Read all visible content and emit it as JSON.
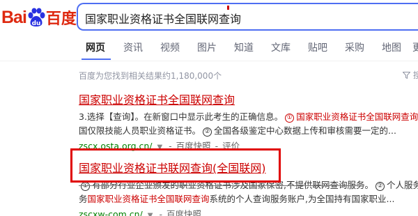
{
  "logo": {
    "text_en": "Bai",
    "paw_icon": "baidu-paw-icon",
    "text_cn": "百度"
  },
  "search": {
    "query": "国家职业资格证书全国联网查询"
  },
  "tabs": [
    {
      "label": "网页",
      "active": true
    },
    {
      "label": "资讯"
    },
    {
      "label": "视频"
    },
    {
      "label": "图片"
    },
    {
      "label": "知道"
    },
    {
      "label": "文库"
    },
    {
      "label": "贴吧"
    },
    {
      "label": "采购"
    },
    {
      "label": "地图"
    },
    {
      "label": "更"
    }
  ],
  "stats": {
    "text": "百度为您找到相关结果约1,180,000个",
    "tools_label": "搜"
  },
  "results": [
    {
      "title": "国家职业资格证书全国联网查询",
      "snippet_line1_a": "3.选择【查询】。在新窗口中显示此考生的正确信息。",
      "snippet_line1_num": "①",
      "snippet_line1_b": "国家职业资格证书全国联网查询",
      "snippet_line2_a": "国仅限技能人员职业资格证书。",
      "snippet_line2_num": "②",
      "snippet_line2_b": "全国各级鉴定中心数据上传和审核需要一定的...",
      "url": "zscx.osta.org.cn/",
      "snapshot": "百度快照",
      "sep": "-",
      "review": "评价"
    },
    {
      "title_main": "国家职业资格证书联网查询",
      "title_paren": "(全国联网)",
      "snippet_line1_num": "①",
      "snippet_line1_a": "有部分行业企业颁发的职业资格证书涉及国家保密,不提供联网查询服务。",
      "snippet_line1_num2": "②",
      "snippet_line1_b": "个人服务",
      "snippet_line2_a": "务",
      "snippet_line2_b": "国家职业资格证书全国联网查询",
      "snippet_line2_c": "系统的个人查询服务账户,为全国持有国家职业...",
      "url": "zscxw-com.cn/",
      "snapshot": "百度快照"
    }
  ],
  "colors": {
    "brand_red": "#de2910",
    "accent_blue": "#4e6ef2",
    "result_red": "#cc0000",
    "url_green": "#008000",
    "annotation_box": "#e00000"
  }
}
